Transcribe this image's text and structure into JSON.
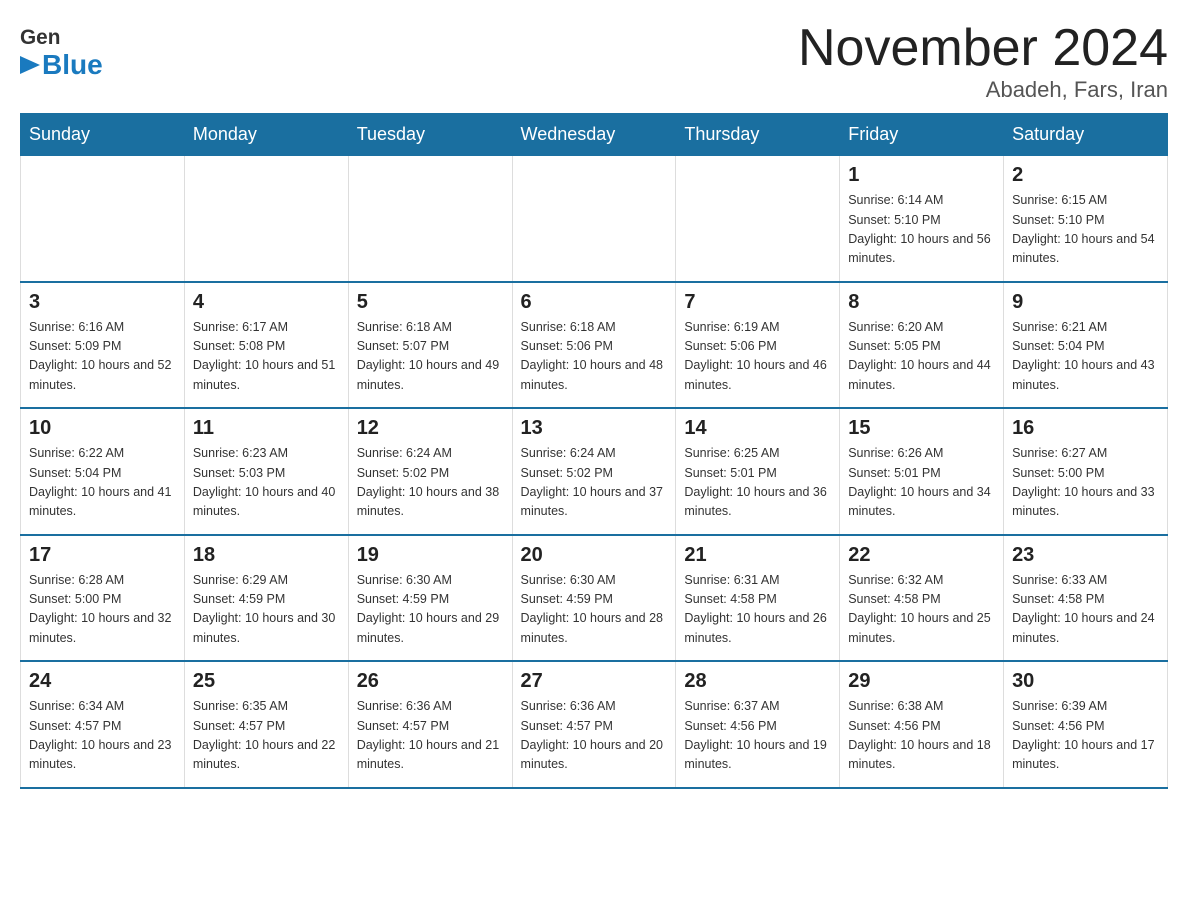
{
  "header": {
    "logo_general": "General",
    "logo_blue": "Blue",
    "month_title": "November 2024",
    "location": "Abadeh, Fars, Iran"
  },
  "weekdays": [
    "Sunday",
    "Monday",
    "Tuesday",
    "Wednesday",
    "Thursday",
    "Friday",
    "Saturday"
  ],
  "weeks": [
    [
      {
        "day": "",
        "info": ""
      },
      {
        "day": "",
        "info": ""
      },
      {
        "day": "",
        "info": ""
      },
      {
        "day": "",
        "info": ""
      },
      {
        "day": "",
        "info": ""
      },
      {
        "day": "1",
        "info": "Sunrise: 6:14 AM\nSunset: 5:10 PM\nDaylight: 10 hours and 56 minutes."
      },
      {
        "day": "2",
        "info": "Sunrise: 6:15 AM\nSunset: 5:10 PM\nDaylight: 10 hours and 54 minutes."
      }
    ],
    [
      {
        "day": "3",
        "info": "Sunrise: 6:16 AM\nSunset: 5:09 PM\nDaylight: 10 hours and 52 minutes."
      },
      {
        "day": "4",
        "info": "Sunrise: 6:17 AM\nSunset: 5:08 PM\nDaylight: 10 hours and 51 minutes."
      },
      {
        "day": "5",
        "info": "Sunrise: 6:18 AM\nSunset: 5:07 PM\nDaylight: 10 hours and 49 minutes."
      },
      {
        "day": "6",
        "info": "Sunrise: 6:18 AM\nSunset: 5:06 PM\nDaylight: 10 hours and 48 minutes."
      },
      {
        "day": "7",
        "info": "Sunrise: 6:19 AM\nSunset: 5:06 PM\nDaylight: 10 hours and 46 minutes."
      },
      {
        "day": "8",
        "info": "Sunrise: 6:20 AM\nSunset: 5:05 PM\nDaylight: 10 hours and 44 minutes."
      },
      {
        "day": "9",
        "info": "Sunrise: 6:21 AM\nSunset: 5:04 PM\nDaylight: 10 hours and 43 minutes."
      }
    ],
    [
      {
        "day": "10",
        "info": "Sunrise: 6:22 AM\nSunset: 5:04 PM\nDaylight: 10 hours and 41 minutes."
      },
      {
        "day": "11",
        "info": "Sunrise: 6:23 AM\nSunset: 5:03 PM\nDaylight: 10 hours and 40 minutes."
      },
      {
        "day": "12",
        "info": "Sunrise: 6:24 AM\nSunset: 5:02 PM\nDaylight: 10 hours and 38 minutes."
      },
      {
        "day": "13",
        "info": "Sunrise: 6:24 AM\nSunset: 5:02 PM\nDaylight: 10 hours and 37 minutes."
      },
      {
        "day": "14",
        "info": "Sunrise: 6:25 AM\nSunset: 5:01 PM\nDaylight: 10 hours and 36 minutes."
      },
      {
        "day": "15",
        "info": "Sunrise: 6:26 AM\nSunset: 5:01 PM\nDaylight: 10 hours and 34 minutes."
      },
      {
        "day": "16",
        "info": "Sunrise: 6:27 AM\nSunset: 5:00 PM\nDaylight: 10 hours and 33 minutes."
      }
    ],
    [
      {
        "day": "17",
        "info": "Sunrise: 6:28 AM\nSunset: 5:00 PM\nDaylight: 10 hours and 32 minutes."
      },
      {
        "day": "18",
        "info": "Sunrise: 6:29 AM\nSunset: 4:59 PM\nDaylight: 10 hours and 30 minutes."
      },
      {
        "day": "19",
        "info": "Sunrise: 6:30 AM\nSunset: 4:59 PM\nDaylight: 10 hours and 29 minutes."
      },
      {
        "day": "20",
        "info": "Sunrise: 6:30 AM\nSunset: 4:59 PM\nDaylight: 10 hours and 28 minutes."
      },
      {
        "day": "21",
        "info": "Sunrise: 6:31 AM\nSunset: 4:58 PM\nDaylight: 10 hours and 26 minutes."
      },
      {
        "day": "22",
        "info": "Sunrise: 6:32 AM\nSunset: 4:58 PM\nDaylight: 10 hours and 25 minutes."
      },
      {
        "day": "23",
        "info": "Sunrise: 6:33 AM\nSunset: 4:58 PM\nDaylight: 10 hours and 24 minutes."
      }
    ],
    [
      {
        "day": "24",
        "info": "Sunrise: 6:34 AM\nSunset: 4:57 PM\nDaylight: 10 hours and 23 minutes."
      },
      {
        "day": "25",
        "info": "Sunrise: 6:35 AM\nSunset: 4:57 PM\nDaylight: 10 hours and 22 minutes."
      },
      {
        "day": "26",
        "info": "Sunrise: 6:36 AM\nSunset: 4:57 PM\nDaylight: 10 hours and 21 minutes."
      },
      {
        "day": "27",
        "info": "Sunrise: 6:36 AM\nSunset: 4:57 PM\nDaylight: 10 hours and 20 minutes."
      },
      {
        "day": "28",
        "info": "Sunrise: 6:37 AM\nSunset: 4:56 PM\nDaylight: 10 hours and 19 minutes."
      },
      {
        "day": "29",
        "info": "Sunrise: 6:38 AM\nSunset: 4:56 PM\nDaylight: 10 hours and 18 minutes."
      },
      {
        "day": "30",
        "info": "Sunrise: 6:39 AM\nSunset: 4:56 PM\nDaylight: 10 hours and 17 minutes."
      }
    ]
  ]
}
